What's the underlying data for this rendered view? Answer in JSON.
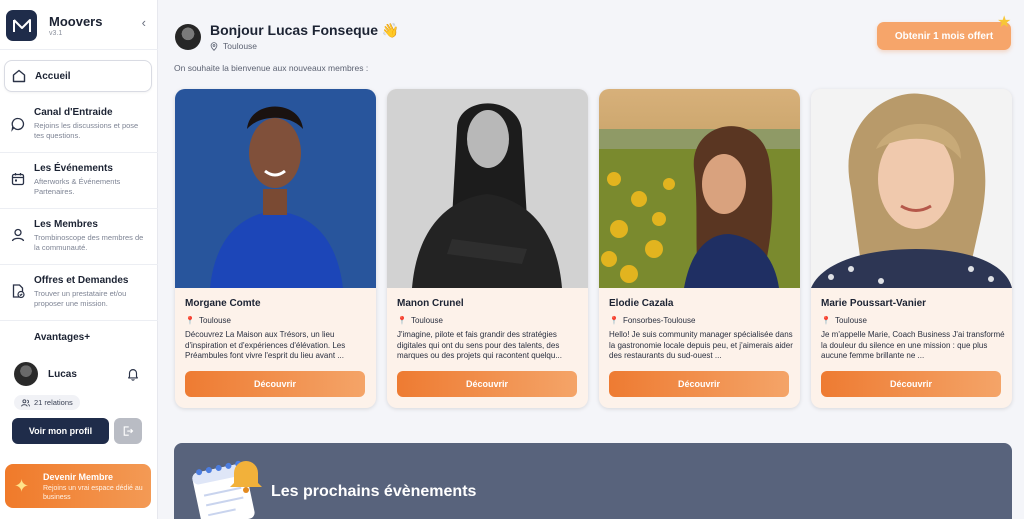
{
  "brand": {
    "name": "Moovers",
    "version": "v3.1"
  },
  "nav": {
    "home": {
      "title": "Accueil"
    },
    "help": {
      "title": "Canal d'Entraide",
      "desc": "Rejoins les discussions et pose tes questions."
    },
    "events": {
      "title": "Les Événements",
      "desc": "Afterworks & Événements Partenaires."
    },
    "members": {
      "title": "Les Membres",
      "desc": "Trombinoscope des membres de la communauté."
    },
    "offers": {
      "title": "Offres et Demandes",
      "desc": "Trouver un prestataire et/ou proposer une mission."
    },
    "perks": {
      "title": "Avantages+"
    }
  },
  "user": {
    "name": "Lucas",
    "relations": "21 relations",
    "profile_button": "Voir mon profil"
  },
  "become_member": {
    "title": "Devenir Membre",
    "desc": "Rejoins un vrai espace dédié au business"
  },
  "header": {
    "greeting": "Bonjour Lucas Fonseque",
    "wave": "👋",
    "location": "Toulouse",
    "offer_button": "Obtenir 1 mois offert"
  },
  "welcome_text": "On souhaite la bienvenue aux nouveaux membres :",
  "members": [
    {
      "name": "Morgane  Comte",
      "location": "Toulouse",
      "bio": "Découvrez La Maison aux Trésors, un lieu d'inspiration et d'expériences d'élévation. Les Préambules font vivre l'esprit du lieu avant ...",
      "button": "Découvrir"
    },
    {
      "name": "Manon Crunel",
      "location": "Toulouse",
      "bio": "J'imagine, pilote et fais grandir des stratégies digitales qui ont du sens pour des talents, des marques ou des projets qui racontent quelqu...",
      "button": "Découvrir"
    },
    {
      "name": "Elodie Cazala",
      "location": "Fonsorbes-Toulouse",
      "bio": "Hello! Je suis community manager spécialisée dans la gastronomie locale depuis peu, et j'aimerais aider des restaurants du sud-ouest ...",
      "button": "Découvrir"
    },
    {
      "name": "Marie Poussart-Vanier",
      "location": "Toulouse",
      "bio": "Je m'appelle Marie, Coach Business J'ai transformé la douleur du silence en une mission : que plus aucune femme brillante ne ...",
      "button": "Découvrir"
    }
  ],
  "events_section": {
    "title": "Les prochains évènements"
  },
  "colors": {
    "accent": "#f07a2a",
    "navy": "#1f2c4a",
    "events_bg": "#58637c"
  }
}
